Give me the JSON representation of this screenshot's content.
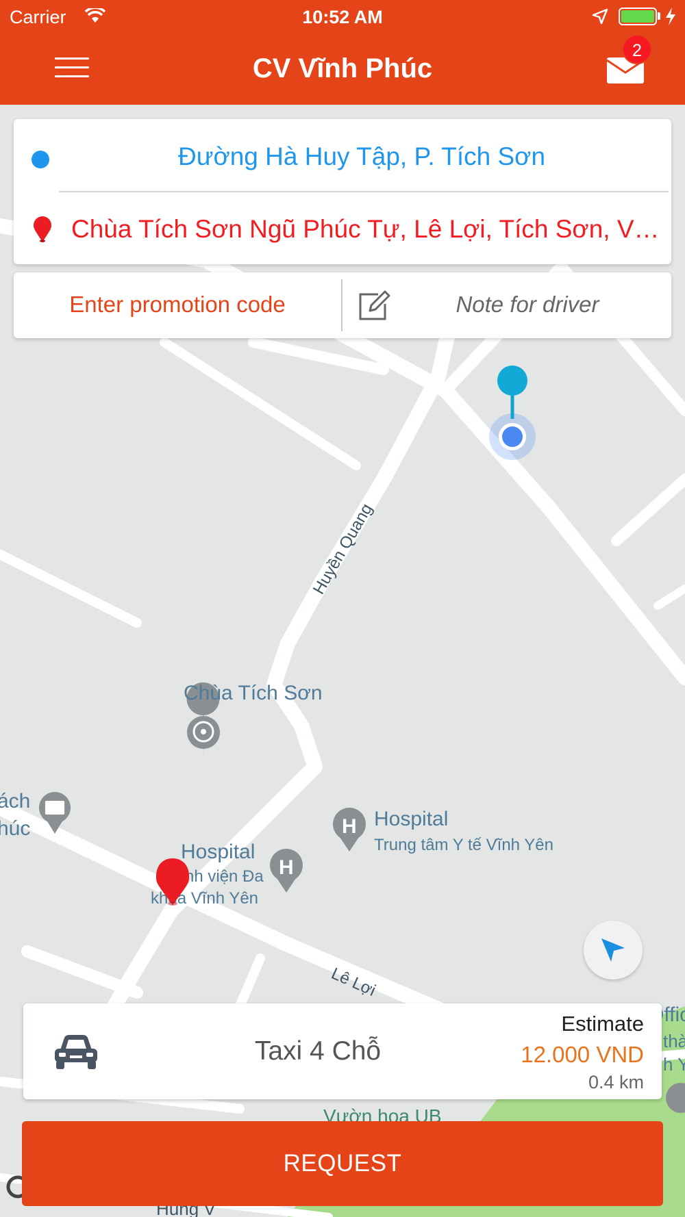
{
  "status_bar": {
    "carrier": "Carrier",
    "time": "10:52 AM",
    "battery_color": "#63d84a"
  },
  "header": {
    "title": "CV Vĩnh Phúc",
    "menu_icon": "hamburger-menu-icon",
    "mail_icon": "mail-icon",
    "notification_count": "2",
    "background_color": "#e54318"
  },
  "trip": {
    "pickup": "Đường Hà Huy Tập, P. Tích Sơn",
    "destination": "Chùa Tích Sơn Ngũ Phúc Tự, Lê Lợi, Tích Sơn, Vĩnh Yên",
    "pickup_color": "#1e96ee",
    "destination_color": "#f11d21"
  },
  "options": {
    "promotion_label": "Enter promotion code",
    "note_placeholder": "Note for driver"
  },
  "map": {
    "labels": {
      "street_huyen_quang": "Huyền Quang",
      "street_le_loi": "Lê Lợi",
      "street_bottom": "Hùng V",
      "temple_name": "Chùa Tích Sơn",
      "hospital_1_title": "Hospital",
      "hospital_1_sub": "Trung tâm Y tế Vĩnh Yên",
      "hospital_2_title": "Hospital",
      "hospital_2_sub_line1": "nh viện Đa",
      "hospital_2_sub_line2": "khoa Vĩnh Yên",
      "left_poi_line1": "ách",
      "left_poi_line2": "húc",
      "right_poi_line1": "Offic",
      "right_poi_line2": "thà",
      "right_poi_line3": "h Y",
      "park": "Vườn hoa UB"
    }
  },
  "service": {
    "name": "Taxi 4 Chỗ",
    "estimate_label": "Estimate",
    "price": "12.000 VND",
    "distance": "0.4 km",
    "icon": "car-icon"
  },
  "actions": {
    "request_label": "REQUEST",
    "locate_icon": "location-arrow-icon"
  }
}
